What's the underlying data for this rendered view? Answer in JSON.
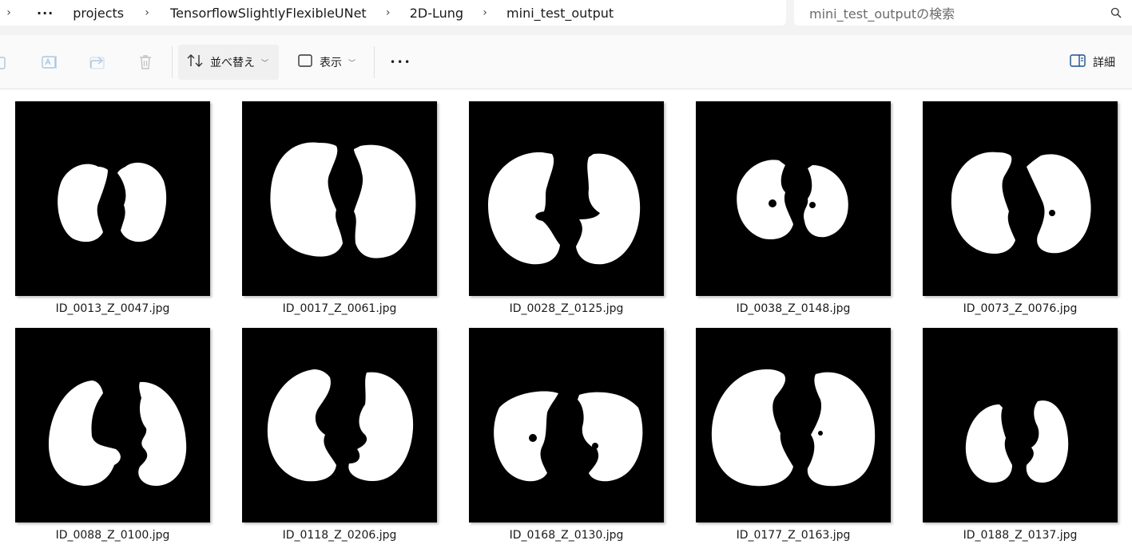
{
  "breadcrumb": {
    "more": "···",
    "items": [
      "projects",
      "TensorflowSlightlyFlexibleUNet",
      "2D-Lung",
      "mini_test_output"
    ]
  },
  "search": {
    "placeholder": "mini_test_outputの検索",
    "icon": "search-icon"
  },
  "toolbar": {
    "sort_label": "並べ替え",
    "view_label": "表示",
    "more_label": "•••",
    "details_label": "詳細"
  },
  "files": [
    {
      "name": "ID_0013_Z_0047.jpg"
    },
    {
      "name": "ID_0017_Z_0061.jpg"
    },
    {
      "name": "ID_0028_Z_0125.jpg"
    },
    {
      "name": "ID_0038_Z_0148.jpg"
    },
    {
      "name": "ID_0073_Z_0076.jpg"
    },
    {
      "name": "ID_0088_Z_0100.jpg"
    },
    {
      "name": "ID_0118_Z_0206.jpg"
    },
    {
      "name": "ID_0168_Z_0130.jpg"
    },
    {
      "name": "ID_0177_Z_0163.jpg"
    },
    {
      "name": "ID_0188_Z_0137.jpg"
    }
  ],
  "colors": {
    "thumb_bg": "#000000",
    "mask": "#ffffff",
    "toolbar_bg": "#fafafa",
    "address_bg": "#f3f3f3"
  }
}
